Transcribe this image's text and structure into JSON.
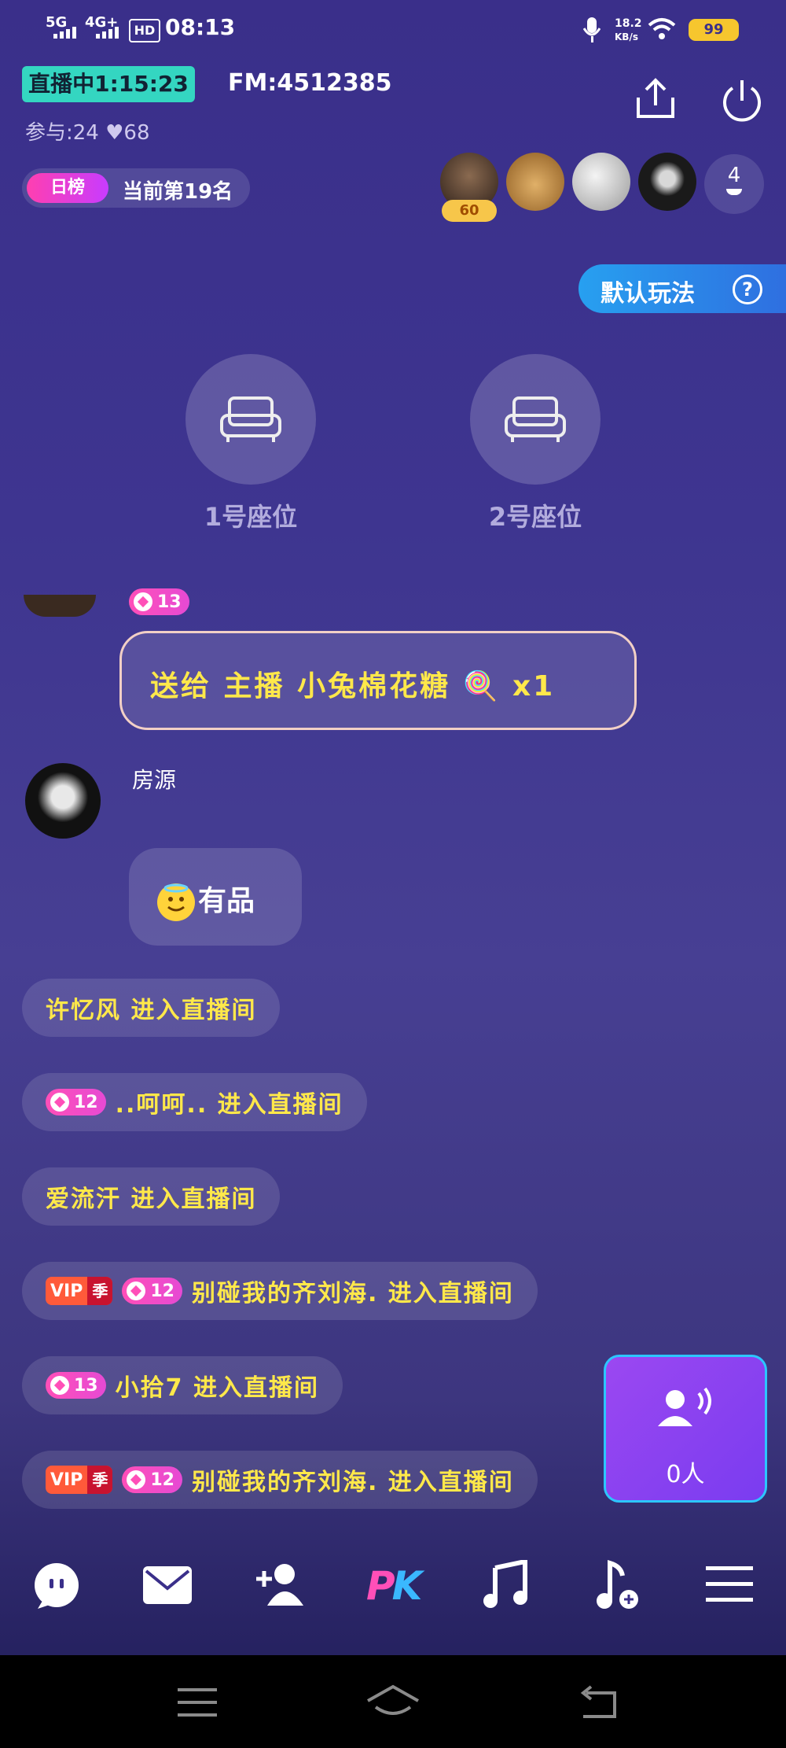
{
  "status_bar": {
    "network1": "5G",
    "network2": "4G+",
    "hd": "HD",
    "time": "08:13",
    "speed_value": "18.2",
    "speed_unit": "KB/s",
    "battery": "99"
  },
  "live": {
    "tag": "直播中1:15:23",
    "fm": "FM:4512385",
    "stats": "参与:24  ♥68"
  },
  "rank": {
    "tag": "日榜",
    "text": "当前第19名"
  },
  "audience": {
    "level_badge": "60",
    "more_count": "4"
  },
  "mode_button": {
    "label": "默认玩法",
    "help": "?"
  },
  "seats": [
    {
      "label": "1号座位"
    },
    {
      "label": "2号座位"
    }
  ],
  "chat": {
    "partial_level": "13",
    "gift_message": "送给 主播 小兔棉花糖 🍭 x1",
    "message_name": "房源",
    "message_text": "有品",
    "entries": [
      {
        "level": "",
        "vip": false,
        "text": "许忆风 进入直播间"
      },
      {
        "level": "12",
        "vip": false,
        "text": "..呵呵.. 进入直播间"
      },
      {
        "level": "",
        "vip": false,
        "text": "爱流汗 进入直播间"
      },
      {
        "level": "12",
        "vip": true,
        "text": "别碰我的齐刘海. 进入直播间"
      },
      {
        "level": "13",
        "vip": false,
        "text": "小拾7 进入直播间"
      },
      {
        "level": "12",
        "vip": true,
        "text": "别碰我的齐刘海. 进入直播间"
      }
    ],
    "vip_label": "VIP",
    "vip_season": "季"
  },
  "listeners": {
    "count": "0人"
  },
  "bottom_bar": {
    "pk_label": "PK",
    "icons": [
      "chat-bubble-icon",
      "mail-icon",
      "add-friend-icon",
      "pk-icon",
      "music-icon",
      "add-music-icon",
      "menu-icon"
    ]
  },
  "colors": {
    "accent_yellow": "#ffe84a",
    "live_tag": "#34d6c1",
    "pink": "#ff4fb8",
    "blue": "#27a0f0"
  }
}
